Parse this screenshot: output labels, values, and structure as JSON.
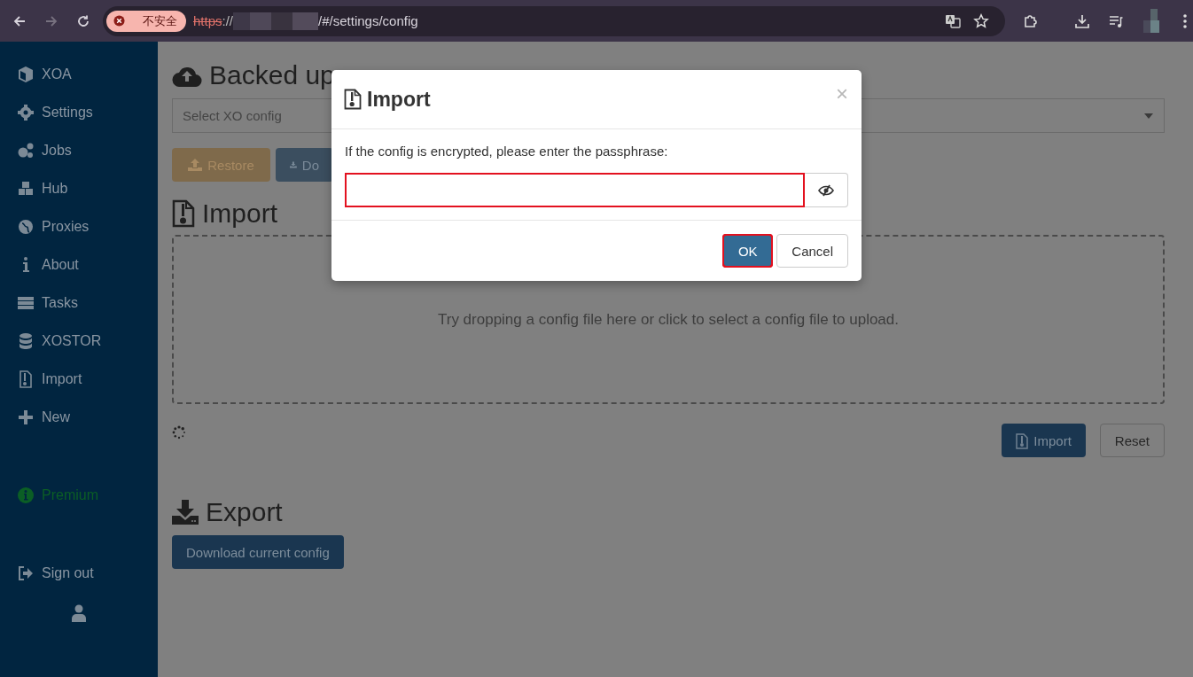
{
  "browser": {
    "nav": [
      {
        "kind": "back",
        "disabled": false
      },
      {
        "kind": "forward",
        "disabled": true
      },
      {
        "kind": "reload",
        "disabled": false
      }
    ],
    "security_chip": "不安全",
    "url": {
      "scheme": "https",
      "rest": "://",
      "path": "/#/settings/config"
    }
  },
  "sidebar": {
    "items": [
      {
        "label": "XOA"
      },
      {
        "label": "Settings"
      },
      {
        "label": "Jobs"
      },
      {
        "label": "Hub"
      },
      {
        "label": "Proxies"
      },
      {
        "label": "About"
      },
      {
        "label": "Tasks"
      },
      {
        "label": "XOSTOR"
      },
      {
        "label": "Import"
      },
      {
        "label": "New"
      }
    ],
    "premium": "Premium",
    "sign_out": "Sign out"
  },
  "backup": {
    "title": "Backed up",
    "select_placeholder": "Select XO config",
    "buttons": [
      {
        "kind": "restore",
        "label": "Restore"
      },
      {
        "kind": "download",
        "label": "Do"
      }
    ]
  },
  "import": {
    "title": "Import",
    "dropzone": "Try dropping a config file here or click to select a config file to upload.",
    "loading": true,
    "buttons": [
      {
        "kind": "primary",
        "label": "Import"
      },
      {
        "kind": "default",
        "label": "Reset"
      }
    ]
  },
  "export": {
    "title": "Export",
    "button": "Download current config"
  },
  "modal": {
    "title": "Import",
    "close": "×",
    "message": "If the config is encrypted, please enter the passphrase:",
    "field_highlighted": true,
    "buttons": [
      {
        "kind": "primary",
        "label": "OK",
        "highlighted": true
      },
      {
        "kind": "default",
        "label": "Cancel",
        "highlighted": false
      }
    ]
  }
}
